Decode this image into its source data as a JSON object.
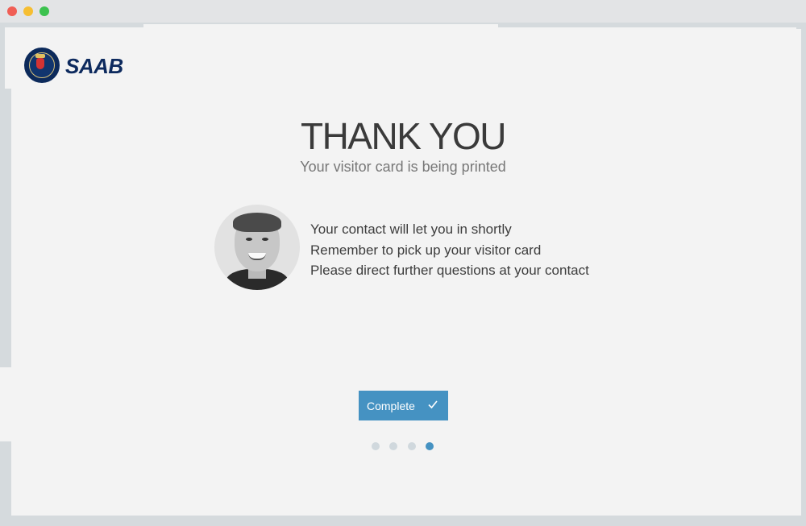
{
  "window": {
    "controls": [
      "close",
      "minimize",
      "maximize"
    ]
  },
  "brand": {
    "name": "SAAB",
    "color": "#0d2a5e"
  },
  "heading": {
    "title": "THANK YOU",
    "subtitle": "Your visitor card is being printed"
  },
  "contact": {
    "avatar_icon": "person-photo",
    "messages": [
      "Your contact will let you in shortly",
      "Remember to pick up your visitor card",
      "Please direct further questions at your contact"
    ]
  },
  "actions": {
    "complete_label": "Complete",
    "complete_icon": "check-icon",
    "accent": "#4592c2"
  },
  "pager": {
    "total": 4,
    "current": 4
  }
}
